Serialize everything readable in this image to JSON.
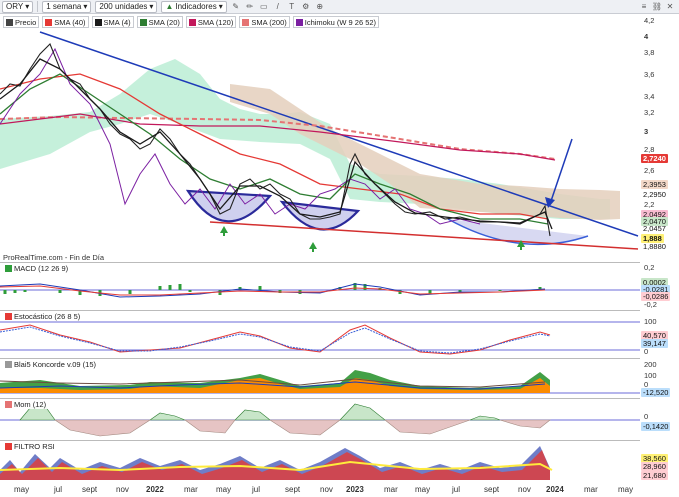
{
  "toolbar": {
    "symbol": "ORY",
    "period": "1 semana",
    "units": "200 unidades",
    "indicators": "Indicadores"
  },
  "legend": {
    "items": [
      {
        "label": "Precio",
        "color": "#444444"
      },
      {
        "label": "SMA (40)",
        "color": "#e53935"
      },
      {
        "label": "SMA (4)",
        "color": "#1a1a1a"
      },
      {
        "label": "SMA (20)",
        "color": "#2e7d32"
      },
      {
        "label": "SMA (120)",
        "color": "#c2185b"
      },
      {
        "label": "SMA (200)",
        "color": "#e57373"
      },
      {
        "label": "Ichimoku (W 9 26 52)",
        "color": "#7b1fa2"
      }
    ]
  },
  "price_axis": {
    "ticks": [
      "4,2",
      "4",
      "3,8",
      "3,6",
      "3,4",
      "3,2",
      "3",
      "2,8",
      "2,6",
      "2,4",
      "2,2",
      "2",
      "1,8",
      "1,6"
    ],
    "tags": [
      {
        "text": "2,7240",
        "bg": "#e53935",
        "fg": "#ffffff"
      },
      {
        "text": "2,3953",
        "bg": "#f3d8c8",
        "fg": "#111111"
      },
      {
        "text": "2,2950",
        "bg": "#ffffff",
        "fg": "#111111"
      },
      {
        "text": "2,0492",
        "bg": "#f8bbd0",
        "fg": "#111111"
      },
      {
        "text": "2,0470",
        "bg": "#c8e6c9",
        "fg": "#111111"
      },
      {
        "text": "2,0457",
        "bg": "#ffffff",
        "fg": "#111111"
      },
      {
        "text": "1,888",
        "bg": "#fff176",
        "fg": "#111111"
      },
      {
        "text": "1,8880",
        "bg": "#ffffff",
        "fg": "#111111"
      }
    ]
  },
  "source": "ProRealTime.com - Fin de Día",
  "panels": {
    "macd": {
      "label": "MACD (12 26 9)",
      "ticks": [
        "0,2",
        "0",
        "-0,2"
      ],
      "tags": [
        {
          "text": "0,0002",
          "bg": "#c8e6c9"
        },
        {
          "text": "-0,0281",
          "bg": "#bbdefb"
        },
        {
          "text": "-0,0286",
          "bg": "#ffcdd2"
        }
      ]
    },
    "stoch": {
      "label": "Estocástico (26 8 5)",
      "ticks": [
        "100",
        "0"
      ],
      "tags": [
        {
          "text": "40,570",
          "bg": "#ffcdd2"
        },
        {
          "text": "39,147",
          "bg": "#bbdefb"
        }
      ]
    },
    "koncorde": {
      "label": "Blai5 Koncorde v.09 (15)",
      "ticks": [
        "200",
        "100",
        "0"
      ],
      "tags": [
        {
          "text": "-12,520",
          "bg": "#bbdefb"
        }
      ]
    },
    "mom": {
      "label": "Mom (12)",
      "ticks": [
        "0",
        "-0,1420"
      ],
      "tags": [
        {
          "text": "-0,1420",
          "bg": "#bbdefb"
        }
      ]
    },
    "filtro": {
      "label": "FILTRO RSI",
      "ticks": [],
      "tags": [
        {
          "text": "38,560",
          "bg": "#fff176"
        },
        {
          "text": "28,960",
          "bg": "#ffcdd2"
        },
        {
          "text": "21,680",
          "bg": "#ffcdd2"
        }
      ]
    }
  },
  "time_axis": [
    "may",
    "jul",
    "sept",
    "nov",
    "2022",
    "mar",
    "may",
    "jul",
    "sept",
    "nov",
    "2023",
    "mar",
    "may",
    "jul",
    "sept",
    "nov",
    "2024",
    "mar",
    "may"
  ],
  "annotations": {
    "arrow_color": "#1e3bb8",
    "marker_color": "#2e9d3a"
  }
}
